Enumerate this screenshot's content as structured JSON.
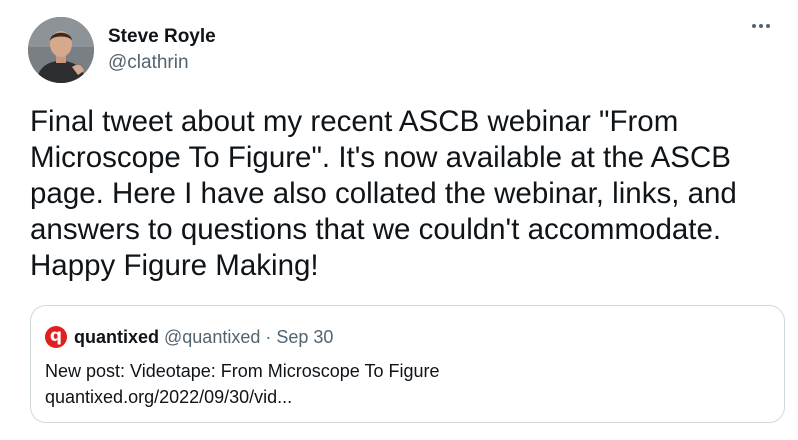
{
  "author": {
    "display_name": "Steve Royle",
    "handle": "@clathrin"
  },
  "more_label": "...",
  "tweet_text": "Final tweet about my recent ASCB webinar \"From\nMicroscope To Figure\". It's now available at the ASCB\npage. Here I have also collated the webinar, links, and\nanswers to questions that we couldn't accommodate.\nHappy Figure Making!",
  "quoted": {
    "logo_letter": "q",
    "display_name": "quantixed",
    "handle": "@quantixed",
    "separator": "·",
    "date": "Sep 30",
    "text": "New post: Videotape: From Microscope To Figure",
    "link": "quantixed.org/2022/09/30/vid..."
  },
  "colors": {
    "text": "#0f1419",
    "secondary_text": "#536471",
    "border": "#cfd9de",
    "quantixed_logo": "#e0201f"
  }
}
